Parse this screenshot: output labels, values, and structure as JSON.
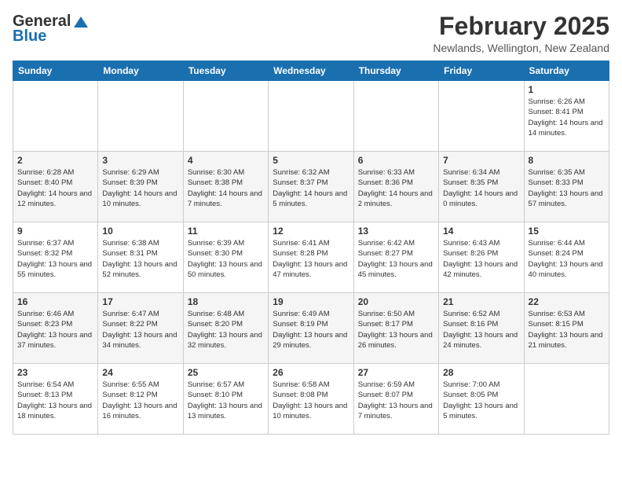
{
  "header": {
    "logo_general": "General",
    "logo_blue": "Blue",
    "month_year": "February 2025",
    "location": "Newlands, Wellington, New Zealand"
  },
  "days_of_week": [
    "Sunday",
    "Monday",
    "Tuesday",
    "Wednesday",
    "Thursday",
    "Friday",
    "Saturday"
  ],
  "weeks": [
    [
      {
        "day": "",
        "info": ""
      },
      {
        "day": "",
        "info": ""
      },
      {
        "day": "",
        "info": ""
      },
      {
        "day": "",
        "info": ""
      },
      {
        "day": "",
        "info": ""
      },
      {
        "day": "",
        "info": ""
      },
      {
        "day": "1",
        "info": "Sunrise: 6:26 AM\nSunset: 8:41 PM\nDaylight: 14 hours and 14 minutes."
      }
    ],
    [
      {
        "day": "2",
        "info": "Sunrise: 6:28 AM\nSunset: 8:40 PM\nDaylight: 14 hours and 12 minutes."
      },
      {
        "day": "3",
        "info": "Sunrise: 6:29 AM\nSunset: 8:39 PM\nDaylight: 14 hours and 10 minutes."
      },
      {
        "day": "4",
        "info": "Sunrise: 6:30 AM\nSunset: 8:38 PM\nDaylight: 14 hours and 7 minutes."
      },
      {
        "day": "5",
        "info": "Sunrise: 6:32 AM\nSunset: 8:37 PM\nDaylight: 14 hours and 5 minutes."
      },
      {
        "day": "6",
        "info": "Sunrise: 6:33 AM\nSunset: 8:36 PM\nDaylight: 14 hours and 2 minutes."
      },
      {
        "day": "7",
        "info": "Sunrise: 6:34 AM\nSunset: 8:35 PM\nDaylight: 14 hours and 0 minutes."
      },
      {
        "day": "8",
        "info": "Sunrise: 6:35 AM\nSunset: 8:33 PM\nDaylight: 13 hours and 57 minutes."
      }
    ],
    [
      {
        "day": "9",
        "info": "Sunrise: 6:37 AM\nSunset: 8:32 PM\nDaylight: 13 hours and 55 minutes."
      },
      {
        "day": "10",
        "info": "Sunrise: 6:38 AM\nSunset: 8:31 PM\nDaylight: 13 hours and 52 minutes."
      },
      {
        "day": "11",
        "info": "Sunrise: 6:39 AM\nSunset: 8:30 PM\nDaylight: 13 hours and 50 minutes."
      },
      {
        "day": "12",
        "info": "Sunrise: 6:41 AM\nSunset: 8:28 PM\nDaylight: 13 hours and 47 minutes."
      },
      {
        "day": "13",
        "info": "Sunrise: 6:42 AM\nSunset: 8:27 PM\nDaylight: 13 hours and 45 minutes."
      },
      {
        "day": "14",
        "info": "Sunrise: 6:43 AM\nSunset: 8:26 PM\nDaylight: 13 hours and 42 minutes."
      },
      {
        "day": "15",
        "info": "Sunrise: 6:44 AM\nSunset: 8:24 PM\nDaylight: 13 hours and 40 minutes."
      }
    ],
    [
      {
        "day": "16",
        "info": "Sunrise: 6:46 AM\nSunset: 8:23 PM\nDaylight: 13 hours and 37 minutes."
      },
      {
        "day": "17",
        "info": "Sunrise: 6:47 AM\nSunset: 8:22 PM\nDaylight: 13 hours and 34 minutes."
      },
      {
        "day": "18",
        "info": "Sunrise: 6:48 AM\nSunset: 8:20 PM\nDaylight: 13 hours and 32 minutes."
      },
      {
        "day": "19",
        "info": "Sunrise: 6:49 AM\nSunset: 8:19 PM\nDaylight: 13 hours and 29 minutes."
      },
      {
        "day": "20",
        "info": "Sunrise: 6:50 AM\nSunset: 8:17 PM\nDaylight: 13 hours and 26 minutes."
      },
      {
        "day": "21",
        "info": "Sunrise: 6:52 AM\nSunset: 8:16 PM\nDaylight: 13 hours and 24 minutes."
      },
      {
        "day": "22",
        "info": "Sunrise: 6:53 AM\nSunset: 8:15 PM\nDaylight: 13 hours and 21 minutes."
      }
    ],
    [
      {
        "day": "23",
        "info": "Sunrise: 6:54 AM\nSunset: 8:13 PM\nDaylight: 13 hours and 18 minutes."
      },
      {
        "day": "24",
        "info": "Sunrise: 6:55 AM\nSunset: 8:12 PM\nDaylight: 13 hours and 16 minutes."
      },
      {
        "day": "25",
        "info": "Sunrise: 6:57 AM\nSunset: 8:10 PM\nDaylight: 13 hours and 13 minutes."
      },
      {
        "day": "26",
        "info": "Sunrise: 6:58 AM\nSunset: 8:08 PM\nDaylight: 13 hours and 10 minutes."
      },
      {
        "day": "27",
        "info": "Sunrise: 6:59 AM\nSunset: 8:07 PM\nDaylight: 13 hours and 7 minutes."
      },
      {
        "day": "28",
        "info": "Sunrise: 7:00 AM\nSunset: 8:05 PM\nDaylight: 13 hours and 5 minutes."
      },
      {
        "day": "",
        "info": ""
      }
    ]
  ]
}
